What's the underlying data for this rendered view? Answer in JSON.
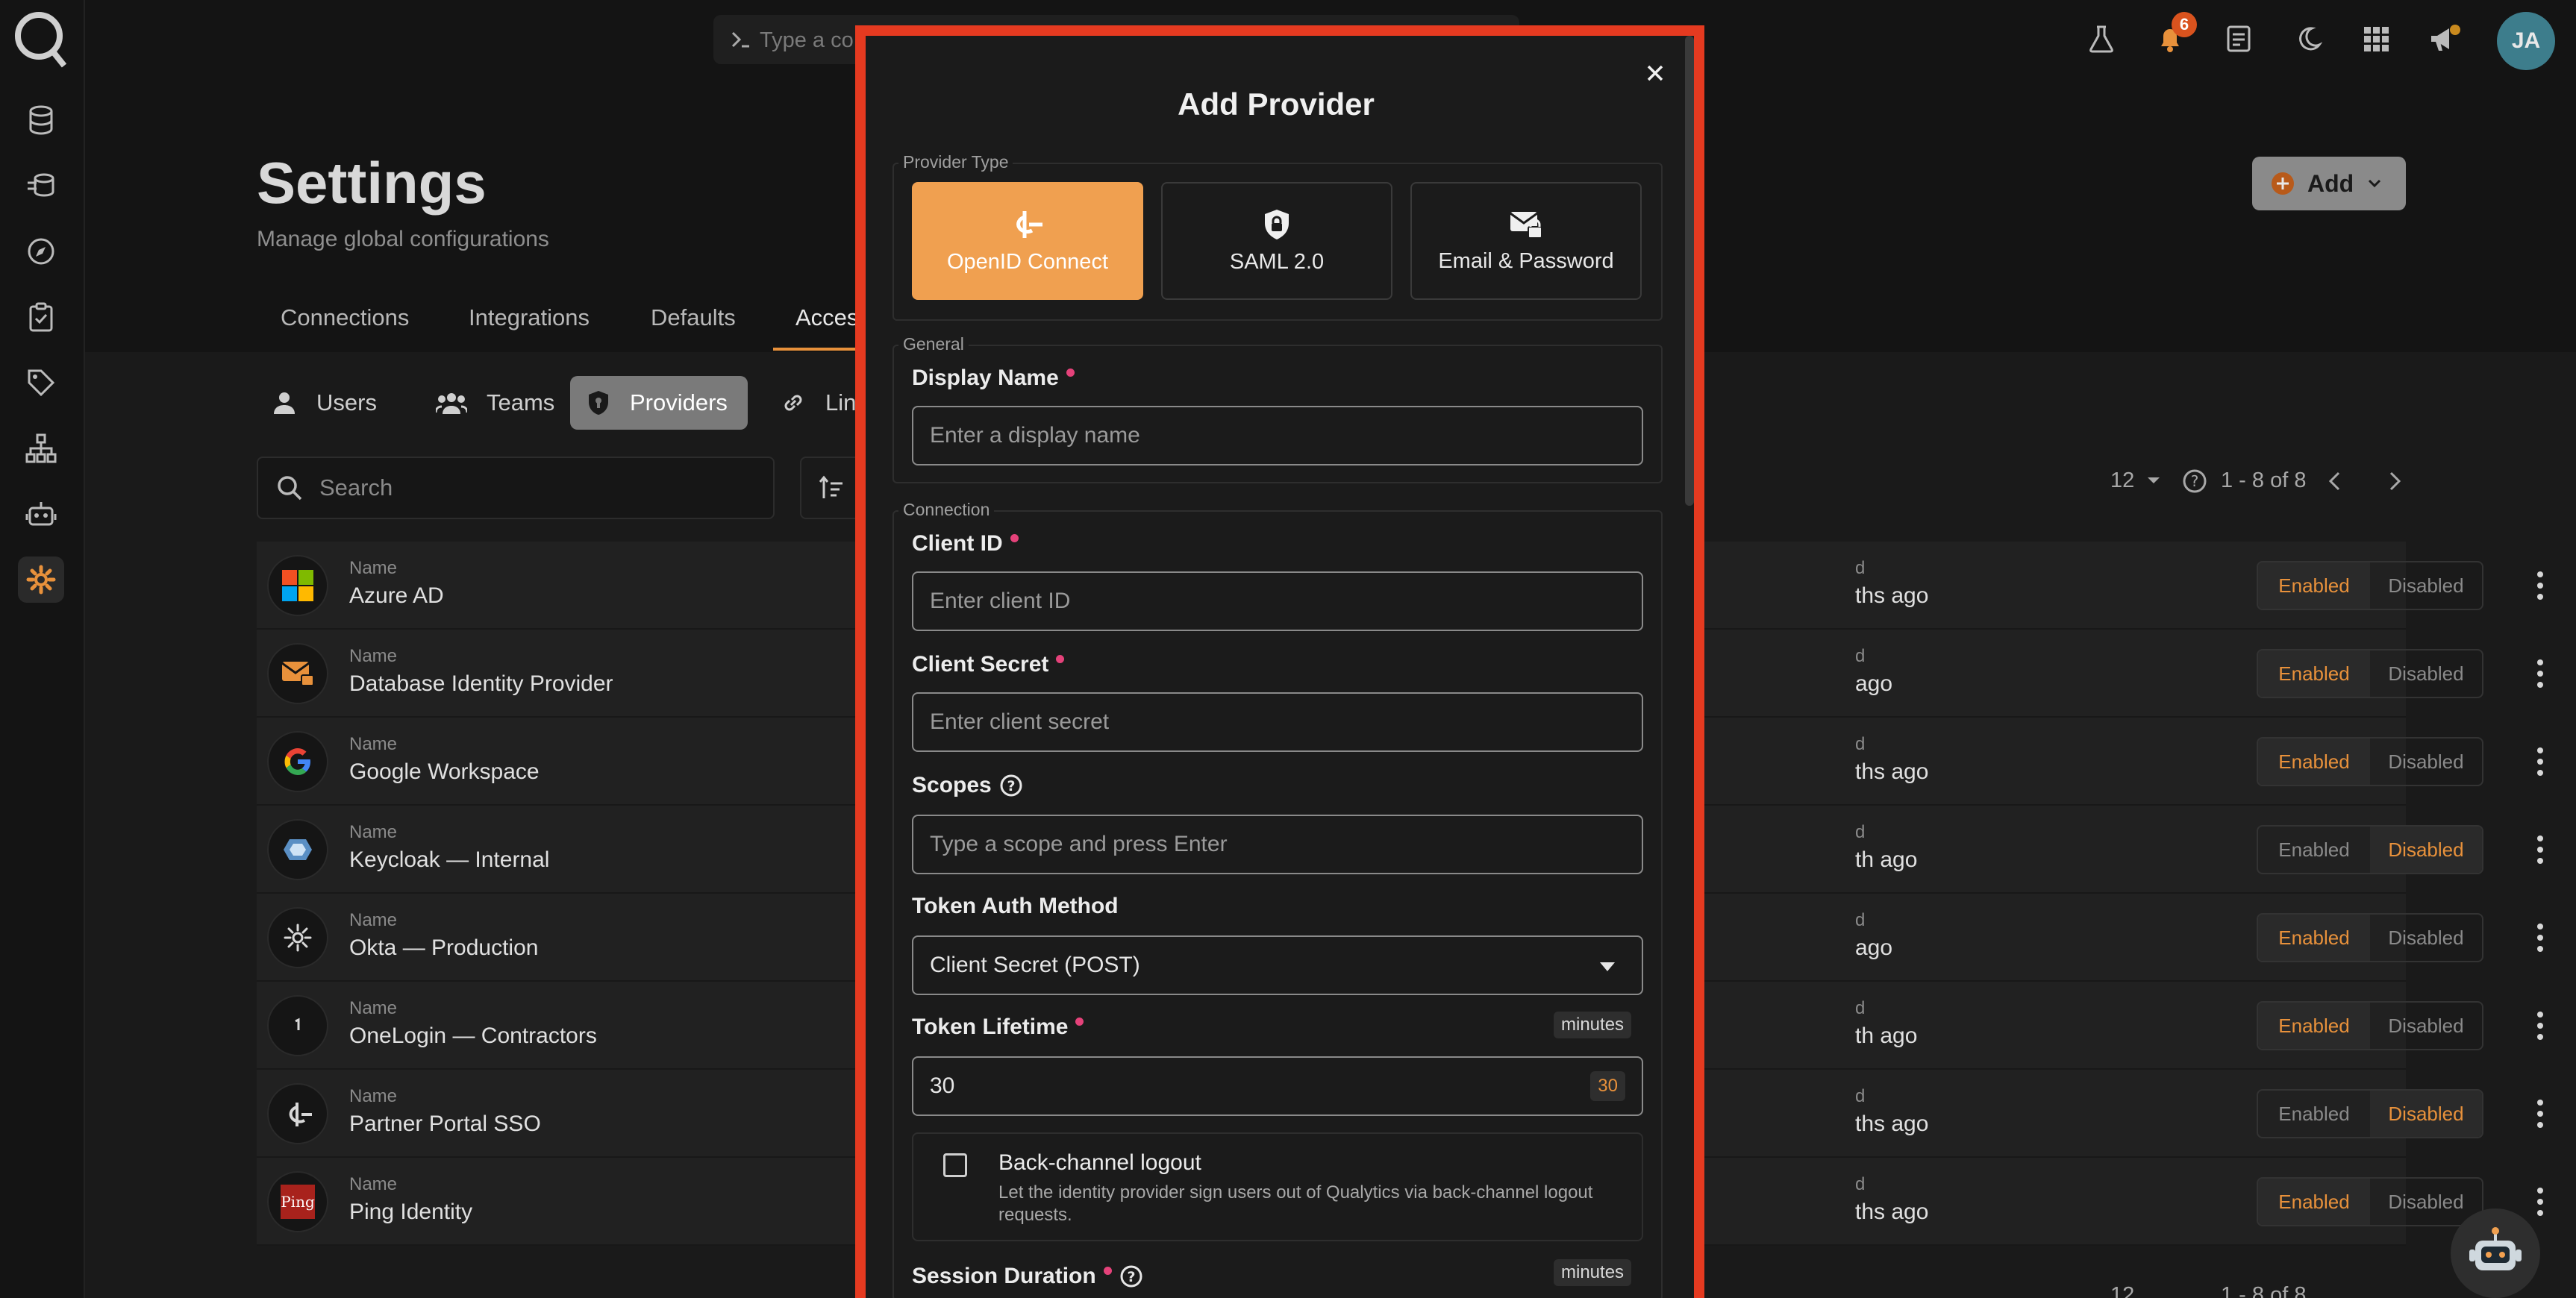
{
  "app": {
    "command_placeholder": "Type a co",
    "notification_count": "6",
    "user_initials": "JA"
  },
  "page": {
    "title": "Settings",
    "subtitle": "Manage global configurations",
    "add_label": "Add"
  },
  "tabs": [
    "Connections",
    "Integrations",
    "Defaults",
    "Acces"
  ],
  "subtabs": [
    "Users",
    "Teams",
    "Providers",
    "Lin"
  ],
  "search": {
    "placeholder": "Search"
  },
  "pagination": {
    "page_size": "12",
    "range": "1 - 8 of 8"
  },
  "providers": [
    {
      "label": "Name",
      "name": "Azure AD",
      "ago": "ths ago",
      "status": "Enabled"
    },
    {
      "label": "Name",
      "name": "Database Identity Provider",
      "ago": "ago",
      "status": "Enabled"
    },
    {
      "label": "Name",
      "name": "Google Workspace",
      "ago": "ths ago",
      "status": "Enabled"
    },
    {
      "label": "Name",
      "name": "Keycloak — Internal",
      "ago": "th ago",
      "status": "Disabled"
    },
    {
      "label": "Name",
      "name": "Okta — Production",
      "ago": "ago",
      "status": "Enabled"
    },
    {
      "label": "Name",
      "name": "OneLogin — Contractors",
      "ago": "th ago",
      "status": "Enabled"
    },
    {
      "label": "Name",
      "name": "Partner Portal SSO",
      "ago": "ths ago",
      "status": "Disabled"
    },
    {
      "label": "Name",
      "name": "Ping Identity",
      "ago": "ths ago",
      "status": "Enabled"
    }
  ],
  "toggle_labels": {
    "enabled": "Enabled",
    "disabled": "Disabled"
  },
  "row_ago_label": "d",
  "modal": {
    "title": "Add Provider",
    "provider_type_legend": "Provider Type",
    "provider_types": [
      {
        "label": "OpenID Connect",
        "icon": "openid-icon",
        "selected": true
      },
      {
        "label": "SAML 2.0",
        "icon": "shield-lock-icon",
        "selected": false
      },
      {
        "label": "Email & Password",
        "icon": "mail-lock-icon",
        "selected": false
      }
    ],
    "general_legend": "General",
    "display_name": {
      "label": "Display Name",
      "placeholder": "Enter a display name"
    },
    "connection_legend": "Connection",
    "client_id": {
      "label": "Client ID",
      "placeholder": "Enter client ID"
    },
    "client_secret": {
      "label": "Client Secret",
      "placeholder": "Enter client secret"
    },
    "scopes": {
      "label": "Scopes",
      "placeholder": "Type a scope and press Enter"
    },
    "token_auth_method": {
      "label": "Token Auth Method",
      "value": "Client Secret (POST)"
    },
    "token_lifetime": {
      "label": "Token Lifetime",
      "unit": "minutes",
      "value": "30",
      "badge": "30"
    },
    "backchannel": {
      "title": "Back-channel logout",
      "description": "Let the identity provider sign users out of Qualytics via back-channel logout requests."
    },
    "session_duration": {
      "label": "Session Duration",
      "unit": "minutes"
    }
  },
  "colors": {
    "accent": "#e8913b",
    "highlight_border": "#e53a20",
    "required": "#e5427a"
  }
}
